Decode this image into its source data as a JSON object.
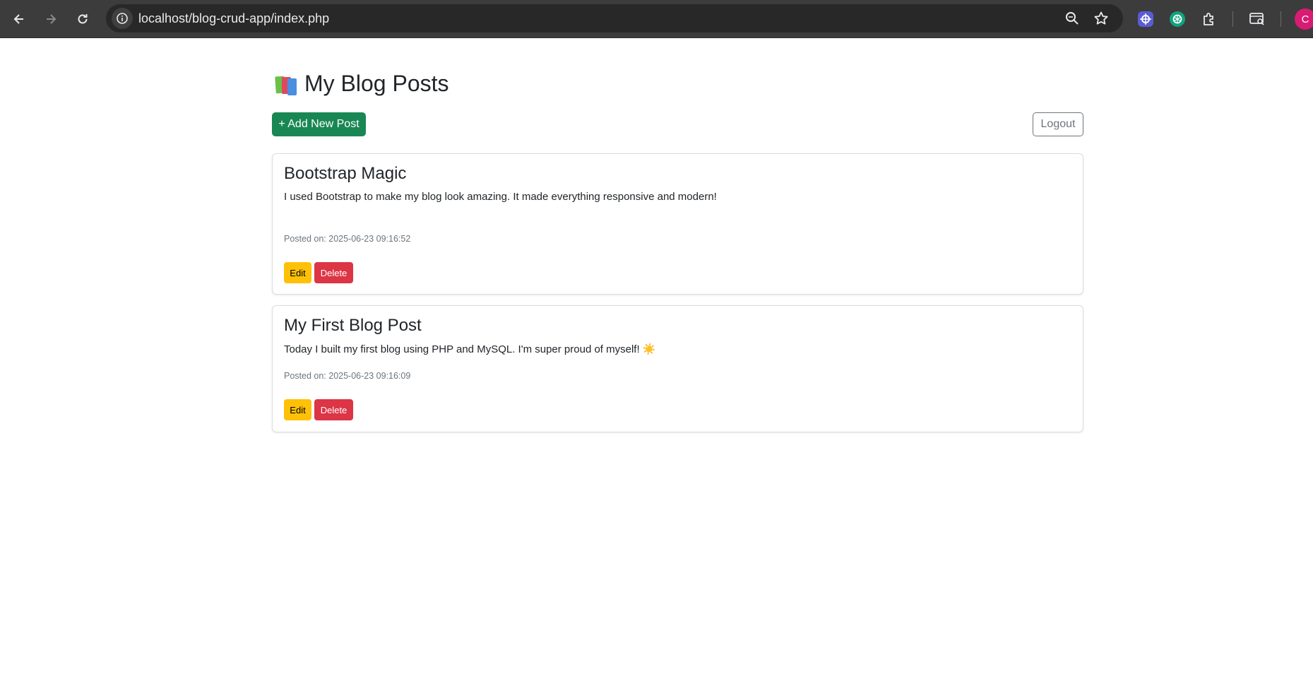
{
  "browser": {
    "url": "localhost/blog-crud-app/index.php",
    "profile_initial": "C"
  },
  "page": {
    "title": "My Blog Posts",
    "add_button": "+ Add New Post",
    "logout_button": "Logout"
  },
  "posts": [
    {
      "title": "Bootstrap Magic",
      "body": "I used Bootstrap to make my blog look amazing. It made everything responsive and modern!",
      "date": "Posted on: 2025-06-23 09:16:52",
      "edit_label": "Edit",
      "delete_label": "Delete"
    },
    {
      "title": "My First Blog Post",
      "body": "Today I built my first blog using PHP and MySQL. I'm super proud of myself! ☀️",
      "date": "Posted on: 2025-06-23 09:16:09",
      "edit_label": "Edit",
      "delete_label": "Delete"
    }
  ],
  "colors": {
    "add_button": "#198754",
    "edit_button": "#ffc107",
    "delete_button": "#dc3545",
    "logout_border": "#6c757d"
  },
  "icons": [
    "back-icon",
    "forward-icon",
    "reload-icon",
    "site-info-icon",
    "zoom-icon",
    "bookmark-star-icon",
    "extension-1-icon",
    "extension-2-icon",
    "extensions-puzzle-icon",
    "tab-search-icon",
    "books-icon"
  ]
}
